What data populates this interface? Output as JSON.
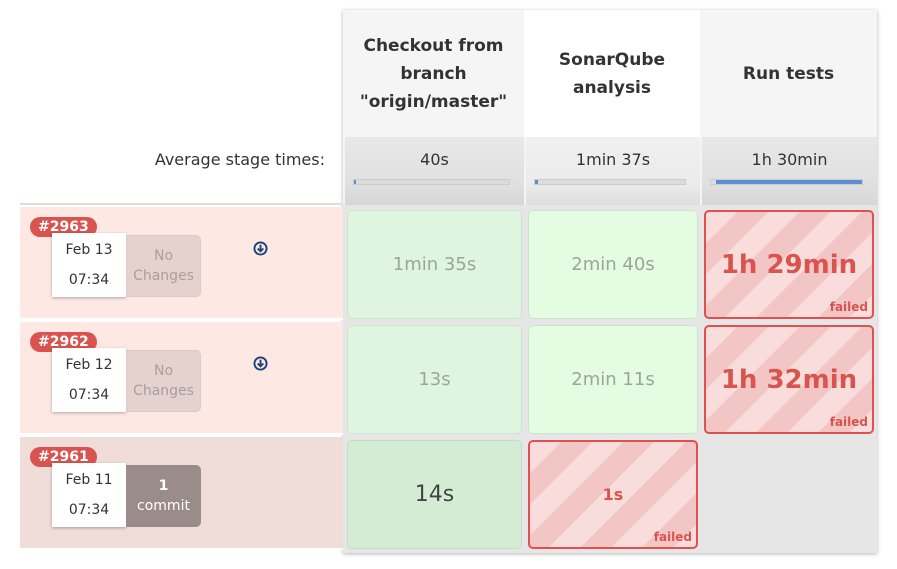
{
  "stages": [
    {
      "name": "Checkout from branch \"origin/master\"",
      "avg": "40s",
      "avg_fraction": 0.01
    },
    {
      "name": "SonarQube analysis",
      "avg": "1min 37s",
      "avg_fraction": 0.02
    },
    {
      "name": "Run tests",
      "avg": "1h 30min",
      "avg_fraction": 0.97
    }
  ],
  "avg_label": "Average stage times:",
  "builds": [
    {
      "id": "#2963",
      "date": "Feb 13",
      "time": "07:34",
      "changes": "No Changes",
      "cells": [
        {
          "t": "1min 35s",
          "status": "success"
        },
        {
          "t": "2min 40s",
          "status": "success"
        },
        {
          "t": "1h 29min",
          "status": "failed"
        }
      ]
    },
    {
      "id": "#2962",
      "date": "Feb 12",
      "time": "07:34",
      "changes": "No Changes",
      "cells": [
        {
          "t": "13s",
          "status": "success"
        },
        {
          "t": "2min 11s",
          "status": "success"
        },
        {
          "t": "1h 32min",
          "status": "failed"
        }
      ]
    },
    {
      "id": "#2961",
      "date": "Feb 11",
      "time": "07:34",
      "changes_count": "1",
      "changes_unit": "commit",
      "cells": [
        {
          "t": "14s",
          "status": "success"
        },
        {
          "t": "1s",
          "status": "failed"
        }
      ]
    }
  ],
  "failed_label": "failed",
  "colors": {
    "failed": "#d9534f",
    "success": "#dff5df",
    "progress": "#5b8fd6"
  }
}
